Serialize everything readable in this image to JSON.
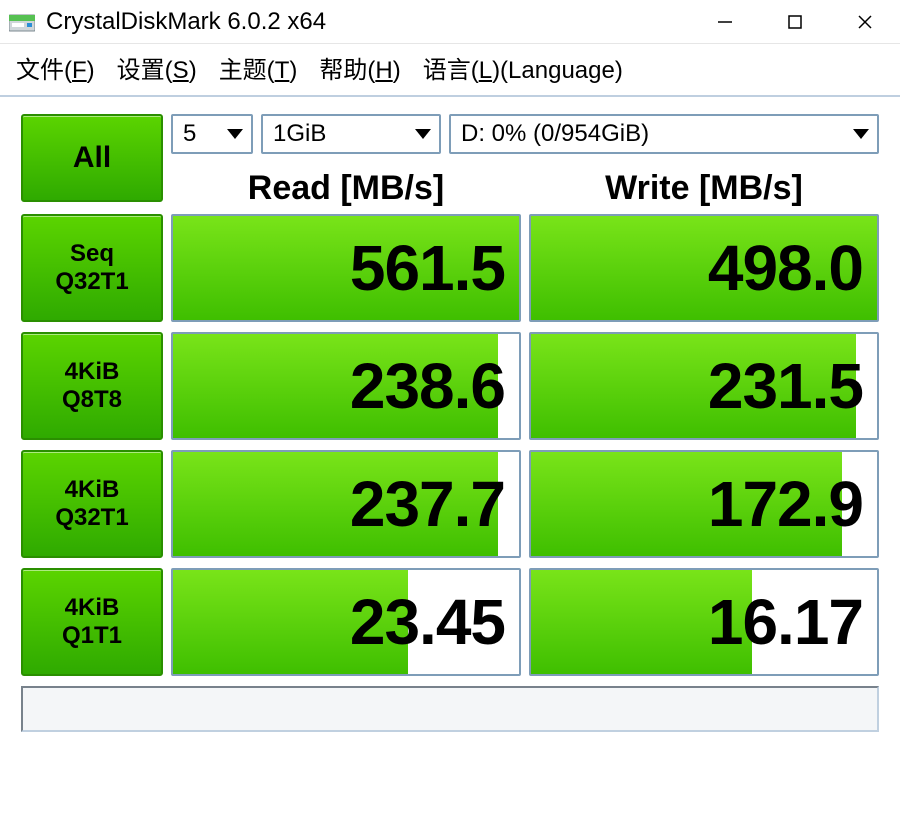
{
  "titlebar": {
    "title": "CrystalDiskMark 6.0.2 x64",
    "icon": "disk-icon"
  },
  "menu": {
    "file": {
      "pre": "文件(",
      "key": "F",
      "post": ")"
    },
    "settings": {
      "pre": "设置(",
      "key": "S",
      "post": ")"
    },
    "theme": {
      "pre": "主题(",
      "key": "T",
      "post": ")"
    },
    "help": {
      "pre": "帮助(",
      "key": "H",
      "post": ")"
    },
    "lang": {
      "pre": "语言(",
      "key": "L",
      "post": ")(Language)"
    }
  },
  "toolbar": {
    "all_label": "All",
    "runs_value": "5",
    "size_value": "1GiB",
    "drive_value": "D: 0% (0/954GiB)"
  },
  "headers": {
    "read": "Read [MB/s]",
    "write": "Write [MB/s]"
  },
  "tests": [
    {
      "label": "Seq\nQ32T1",
      "read": "561.5",
      "read_pct": 100,
      "write": "498.0",
      "write_pct": 100
    },
    {
      "label": "4KiB\nQ8T8",
      "read": "238.6",
      "read_pct": 94,
      "write": "231.5",
      "write_pct": 94
    },
    {
      "label": "4KiB\nQ32T1",
      "read": "237.7",
      "read_pct": 94,
      "write": "172.9",
      "write_pct": 90
    },
    {
      "label": "4KiB\nQ1T1",
      "read": "23.45",
      "read_pct": 68,
      "write": "16.17",
      "write_pct": 64
    }
  ]
}
